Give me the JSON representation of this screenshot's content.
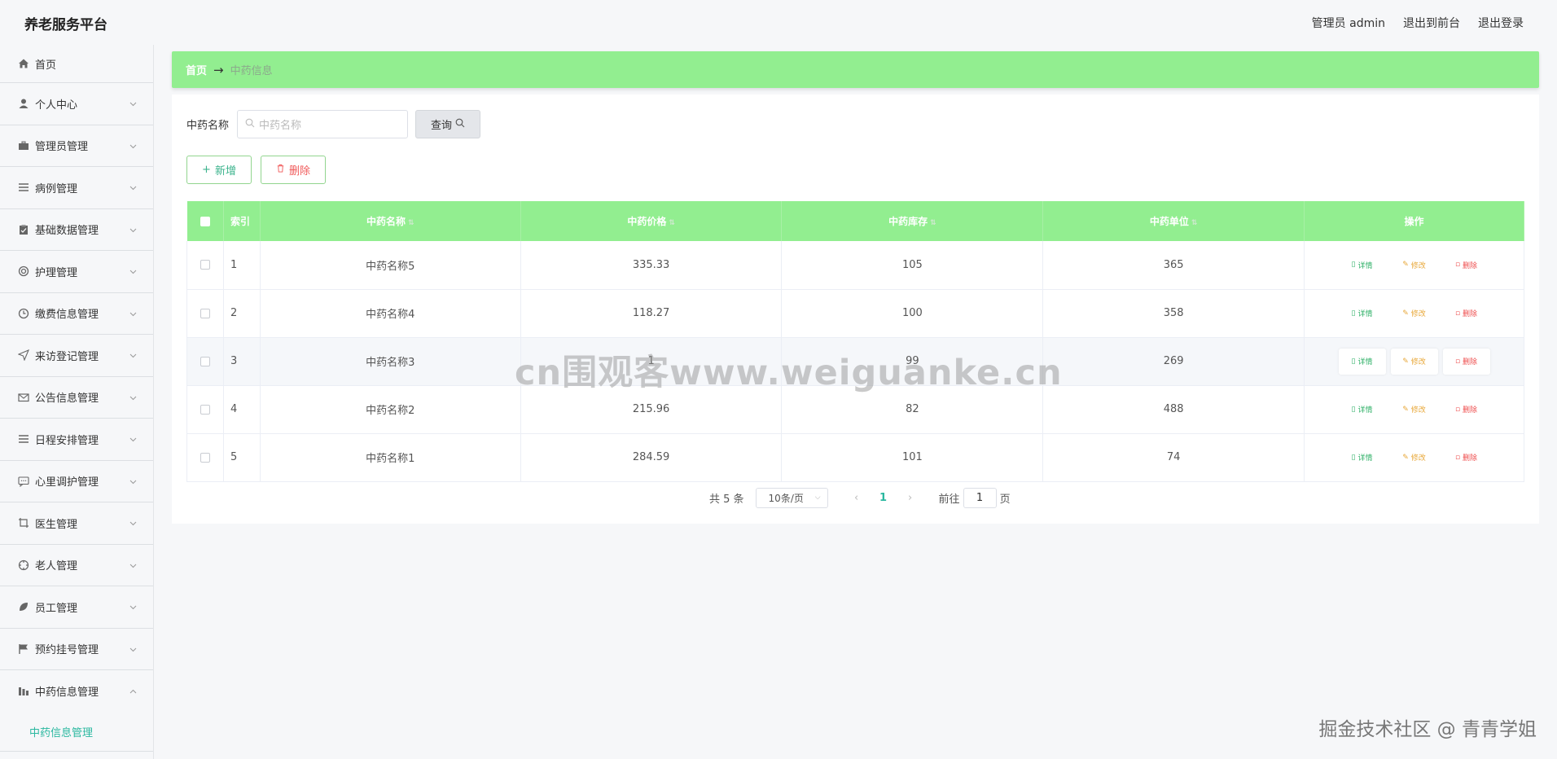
{
  "header": {
    "brand": "养老服务平台",
    "admin_label": "管理员 admin",
    "back_front": "退出到前台",
    "logout": "退出登录"
  },
  "sidebar": {
    "items": [
      {
        "label": "首页",
        "icon": "home-icon"
      },
      {
        "label": "个人中心",
        "icon": "user-icon"
      },
      {
        "label": "管理员管理",
        "icon": "briefcase-icon"
      },
      {
        "label": "病例管理",
        "icon": "list-icon"
      },
      {
        "label": "基础数据管理",
        "icon": "clipboard-icon"
      },
      {
        "label": "护理管理",
        "icon": "lifebuoy-icon"
      },
      {
        "label": "缴费信息管理",
        "icon": "clock-icon"
      },
      {
        "label": "来访登记管理",
        "icon": "send-icon"
      },
      {
        "label": "公告信息管理",
        "icon": "mail-icon"
      },
      {
        "label": "日程安排管理",
        "icon": "menu-icon"
      },
      {
        "label": "心里调护管理",
        "icon": "chat-icon"
      },
      {
        "label": "医生管理",
        "icon": "crop-icon"
      },
      {
        "label": "老人管理",
        "icon": "compass-icon"
      },
      {
        "label": "员工管理",
        "icon": "leaf-icon"
      },
      {
        "label": "预约挂号管理",
        "icon": "flag-icon"
      },
      {
        "label": "中药信息管理",
        "icon": "chart-icon"
      }
    ],
    "submenu": {
      "label": "中药信息管理"
    }
  },
  "breadcrumb": {
    "home": "首页",
    "arrow": "→",
    "current": "中药信息"
  },
  "search": {
    "label": "中药名称",
    "placeholder": "中药名称",
    "button": "查询"
  },
  "actions": {
    "add": "新增",
    "delete": "删除"
  },
  "table": {
    "headers": [
      "索引",
      "中药名称",
      "中药价格",
      "中药库存",
      "中药单位",
      "操作"
    ],
    "rows": [
      {
        "idx": "1",
        "name": "中药名称5",
        "price": "335.33",
        "stock": "105",
        "unit": "365"
      },
      {
        "idx": "2",
        "name": "中药名称4",
        "price": "118.27",
        "stock": "100",
        "unit": "358"
      },
      {
        "idx": "3",
        "name": "中药名称3",
        "price": "1",
        "stock": "99",
        "unit": "269"
      },
      {
        "idx": "4",
        "name": "中药名称2",
        "price": "215.96",
        "stock": "82",
        "unit": "488"
      },
      {
        "idx": "5",
        "name": "中药名称1",
        "price": "284.59",
        "stock": "101",
        "unit": "74"
      }
    ],
    "op_detail": "详情",
    "op_edit": "修改",
    "op_delete": "删除"
  },
  "pagination": {
    "total": "共 5 条",
    "page_size": "10条/页",
    "current": "1",
    "goto_prefix": "前往",
    "goto_value": "1",
    "goto_suffix": "页"
  },
  "watermarks": {
    "center": "cn围观客www.weiguanke.cn",
    "corner": "掘金技术社区 @ 青青学姐"
  },
  "colors": {
    "accent_green": "#92ee90",
    "teal": "#2bb8a0",
    "danger": "#f05a5a"
  }
}
